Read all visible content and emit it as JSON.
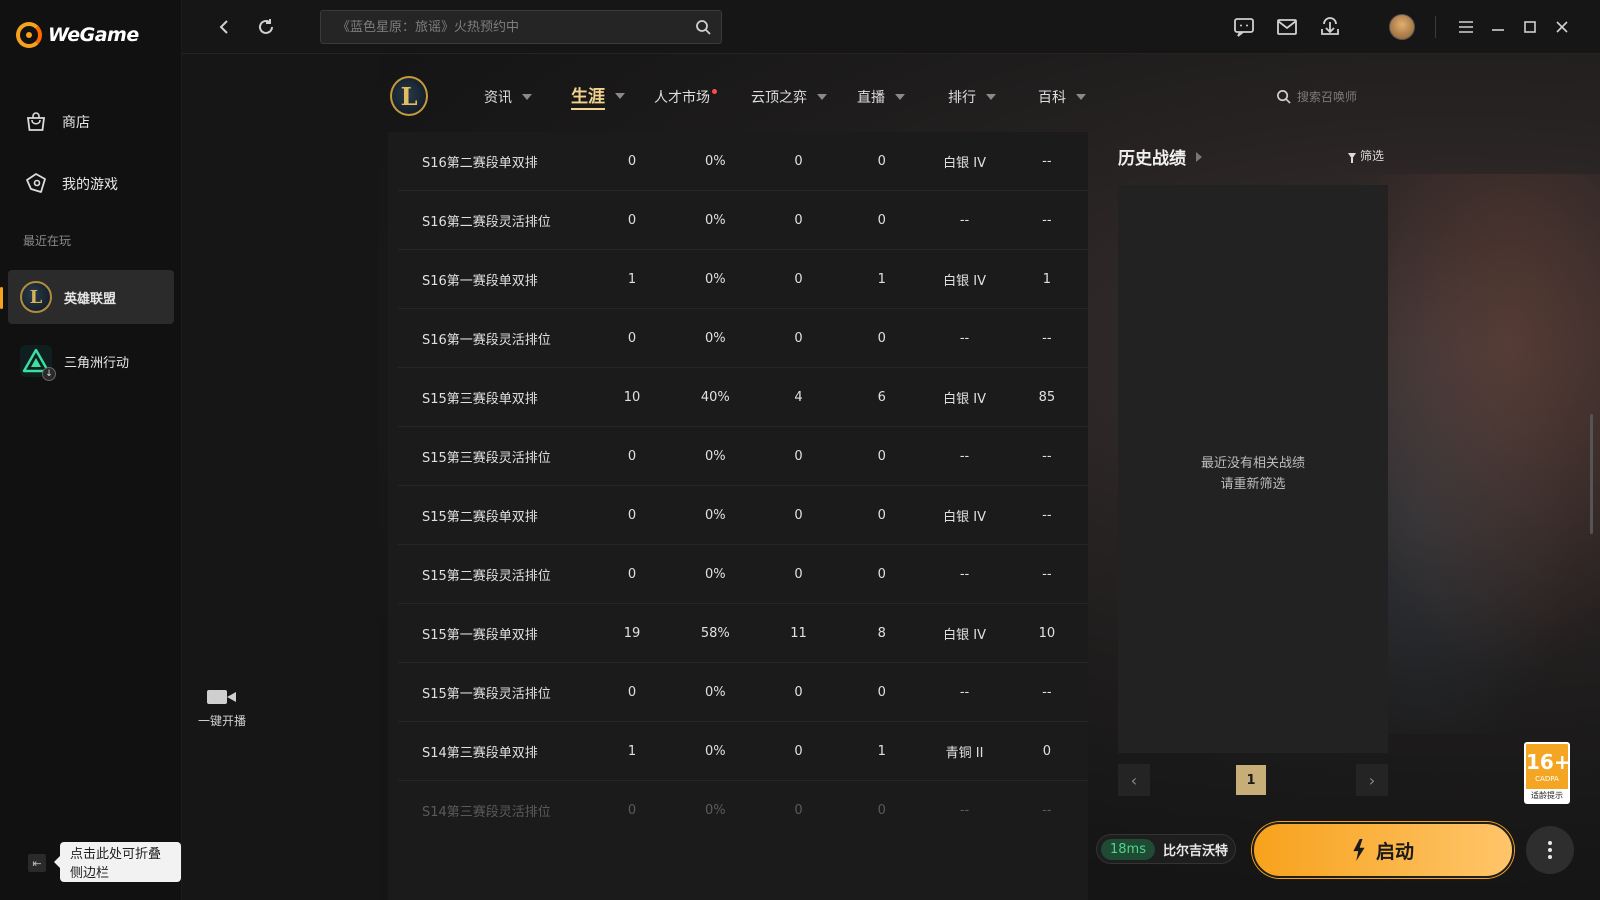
{
  "app": {
    "name": "WeGame",
    "accent": "#f7a21c"
  },
  "sidebar": {
    "items": [
      {
        "label": "商店",
        "icon": "shopping-bag-icon"
      },
      {
        "label": "我的游戏",
        "icon": "gamepad-icon"
      }
    ],
    "recent_label": "最近在玩",
    "games": [
      {
        "label": "英雄联盟",
        "icon": "league-of-legends-icon",
        "active": true
      },
      {
        "label": "三角洲行动",
        "icon": "delta-force-icon",
        "active": false
      }
    ],
    "collapse_tooltip": "点击此处可折叠侧边栏"
  },
  "topbar": {
    "search_placeholder": "《蓝色星原：旅谣》火热预约中"
  },
  "livecast": {
    "label": "一键开播"
  },
  "game_nav": {
    "items": [
      {
        "label": "资讯",
        "caret": true
      },
      {
        "label": "生涯",
        "caret": true,
        "active": true
      },
      {
        "label": "人才市场",
        "dot": true
      },
      {
        "label": "云顶之弈",
        "caret": true
      },
      {
        "label": "直播",
        "caret": true
      },
      {
        "label": "排行",
        "caret": true
      },
      {
        "label": "百科",
        "caret": true
      }
    ],
    "summoner_search_placeholder": "搜索召唤师"
  },
  "stats_table": {
    "rows": [
      [
        "S16第二赛段单双排",
        "0",
        "0%",
        "0",
        "0",
        "白银 IV",
        "--"
      ],
      [
        "S16第二赛段灵活排位",
        "0",
        "0%",
        "0",
        "0",
        "--",
        "--"
      ],
      [
        "S16第一赛段单双排",
        "1",
        "0%",
        "0",
        "1",
        "白银 IV",
        "1"
      ],
      [
        "S16第一赛段灵活排位",
        "0",
        "0%",
        "0",
        "0",
        "--",
        "--"
      ],
      [
        "S15第三赛段单双排",
        "10",
        "40%",
        "4",
        "6",
        "白银 IV",
        "85"
      ],
      [
        "S15第三赛段灵活排位",
        "0",
        "0%",
        "0",
        "0",
        "--",
        "--"
      ],
      [
        "S15第二赛段单双排",
        "0",
        "0%",
        "0",
        "0",
        "白银 IV",
        "--"
      ],
      [
        "S15第二赛段灵活排位",
        "0",
        "0%",
        "0",
        "0",
        "--",
        "--"
      ],
      [
        "S15第一赛段单双排",
        "19",
        "58%",
        "11",
        "8",
        "白银 IV",
        "10"
      ],
      [
        "S15第一赛段灵活排位",
        "0",
        "0%",
        "0",
        "0",
        "--",
        "--"
      ],
      [
        "S14第三赛段单双排",
        "1",
        "0%",
        "0",
        "1",
        "青铜 II",
        "0"
      ],
      [
        "S14第三赛段灵活排位",
        "0",
        "0%",
        "0",
        "0",
        "--",
        "--"
      ]
    ]
  },
  "history": {
    "title": "历史战绩",
    "filter_label": "筛选",
    "empty_line1": "最近没有相关战绩",
    "empty_line2": "请重新筛选",
    "current_page": "1"
  },
  "age_rating": {
    "number": "16+",
    "org": "CADPA",
    "tip": "适龄提示"
  },
  "launch": {
    "ping": "18ms",
    "server": "比尔吉沃特",
    "button_label": "启动"
  }
}
